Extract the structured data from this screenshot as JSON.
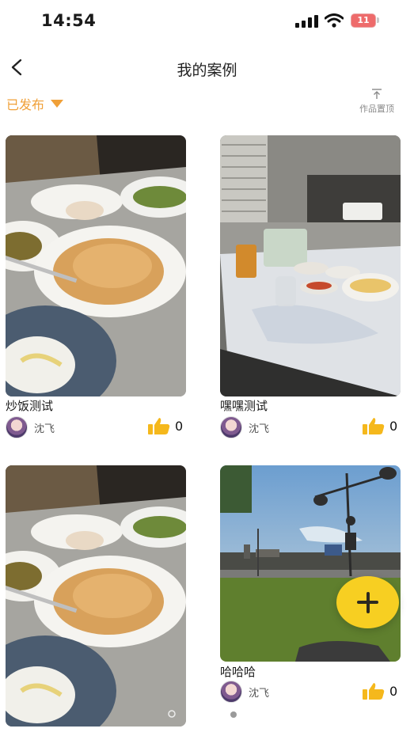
{
  "status_bar": {
    "time": "14:54",
    "battery": "11"
  },
  "nav": {
    "title": "我的案例"
  },
  "filter": {
    "label": "已发布"
  },
  "pin": {
    "label": "作品置顶"
  },
  "cards": [
    {
      "title": "炒饭测试",
      "author": "沈飞",
      "likes": "0"
    },
    {
      "title": "嘿嘿测试",
      "author": "沈飞",
      "likes": "0"
    },
    {
      "title": "",
      "author": "",
      "likes": ""
    },
    {
      "title": "哈哈哈",
      "author": "沈飞",
      "likes": "0"
    }
  ],
  "icons": [
    "chevron-left-icon",
    "caret-down-icon",
    "pin-top-icon",
    "thumbs-up-icon",
    "plus-icon"
  ],
  "colors": {
    "accent": "#f0a038",
    "like": "#f5b81c",
    "fab": "#f7cf22",
    "battery": "#ee6b6b"
  }
}
